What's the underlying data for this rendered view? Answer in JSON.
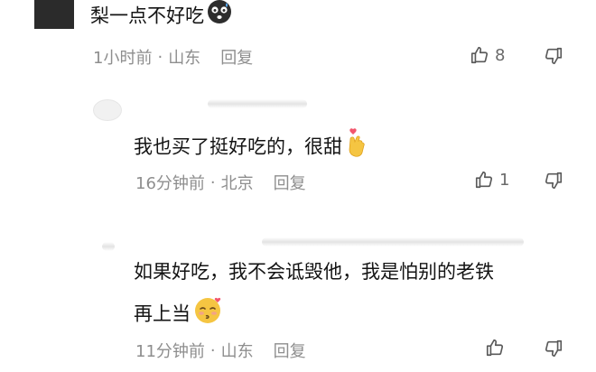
{
  "comments": [
    {
      "text": "梨一点不好吃",
      "emoji": "dizzy-face-emoji",
      "time": "1小时前",
      "separator": "·",
      "location": "山东",
      "reply_label": "回复",
      "likes": "8"
    },
    {
      "text": "我也买了挺好吃的，很甜",
      "emoji": "heart-hand-emoji",
      "time": "16分钟前",
      "separator": "·",
      "location": "北京",
      "reply_label": "回复",
      "likes": "1"
    },
    {
      "text_line1": "如果好吃，我不会诋毁他，我是怕别的老铁",
      "text_line2": "再上当",
      "emoji": "blowing-kiss-emoji",
      "time": "11分钟前",
      "separator": "·",
      "location": "山东",
      "reply_label": "回复",
      "likes": ""
    }
  ],
  "icons": {
    "like": "thumbs-up-icon",
    "dislike": "thumbs-down-icon"
  },
  "colors": {
    "text": "#141414",
    "meta": "#8e8e8e",
    "emoji_yellow": "#f5c542"
  }
}
